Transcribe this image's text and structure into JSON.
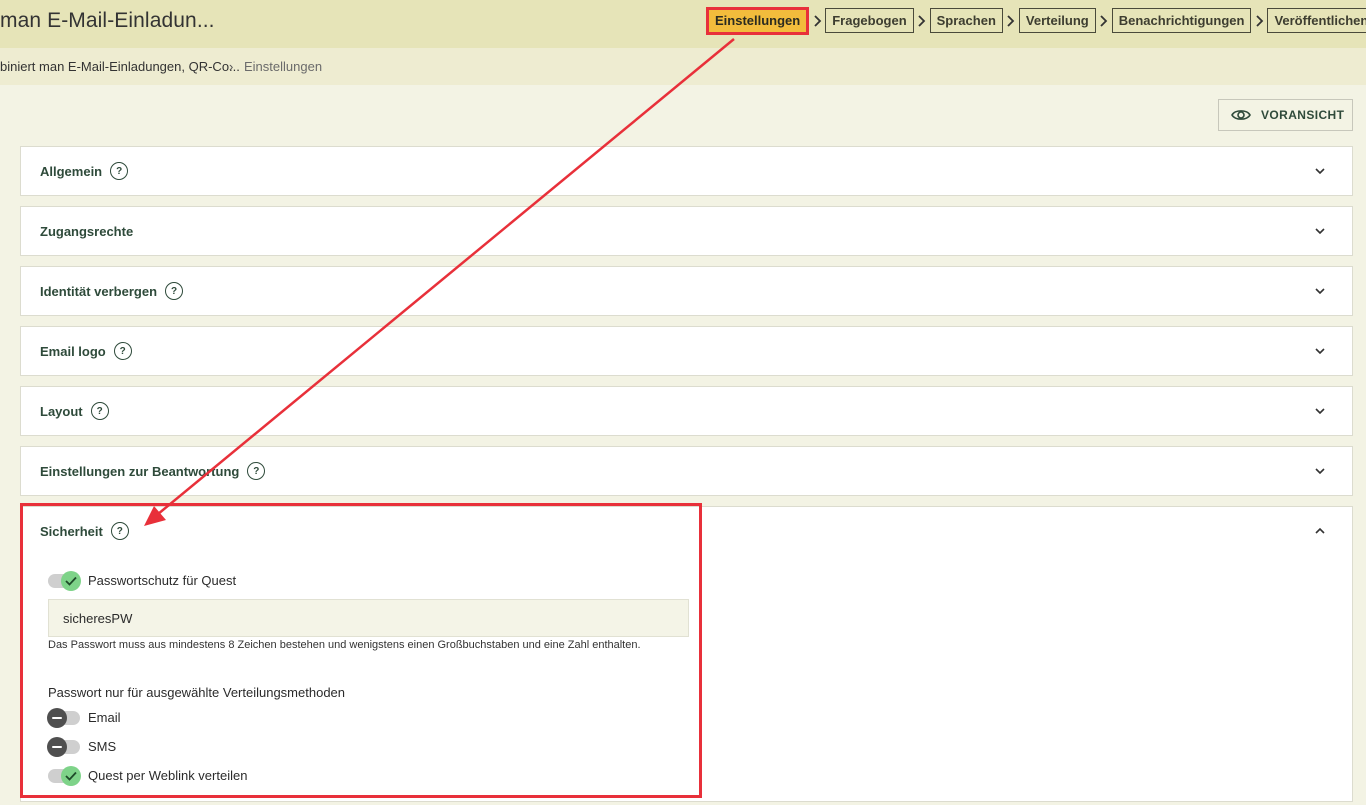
{
  "header": {
    "title": "man E-Mail-Einladun...",
    "steps": [
      {
        "label": "Einstellungen"
      },
      {
        "label": "Fragebogen"
      },
      {
        "label": "Sprachen"
      },
      {
        "label": "Verteilung"
      },
      {
        "label": "Benachrichtigungen"
      },
      {
        "label": "Veröffentlichen"
      }
    ]
  },
  "breadcrumb": {
    "parent": "biniert man E-Mail-Einladungen, QR-Co...",
    "separator": "›",
    "current": "Einstellungen"
  },
  "preview_label": "VORANSICHT",
  "panels": [
    {
      "label": "Allgemein",
      "help": "?"
    },
    {
      "label": "Zugangsrechte"
    },
    {
      "label": "Identität verbergen",
      "help": "?"
    },
    {
      "label": "Email logo",
      "help": "?"
    },
    {
      "label": "Layout",
      "help": "?"
    },
    {
      "label": "Einstellungen zur Beantwortung",
      "help": "?"
    },
    {
      "label": "Sicherheit",
      "help": "?"
    }
  ],
  "security": {
    "password_protection_label": "Passwortschutz für Quest",
    "password_protection_on": true,
    "password_value": "sicheresPW",
    "password_hint": "Das Passwort muss aus mindestens 8 Zeichen bestehen und wenigstens einen Großbuchstaben und eine Zahl enthalten.",
    "methods_label": "Passwort nur für ausgewählte Verteilungsmethoden",
    "methods": [
      {
        "label": "Email",
        "on": false
      },
      {
        "label": "SMS",
        "on": false
      },
      {
        "label": "Quest per Weblink verteilen",
        "on": true
      }
    ]
  },
  "colors": {
    "accent_active_step": "#f2bc3c",
    "highlight_red": "#e8303a",
    "toggle_on": "#7ed389",
    "toggle_off": "#4f4f4f",
    "heading_green": "#2e4a3a"
  }
}
